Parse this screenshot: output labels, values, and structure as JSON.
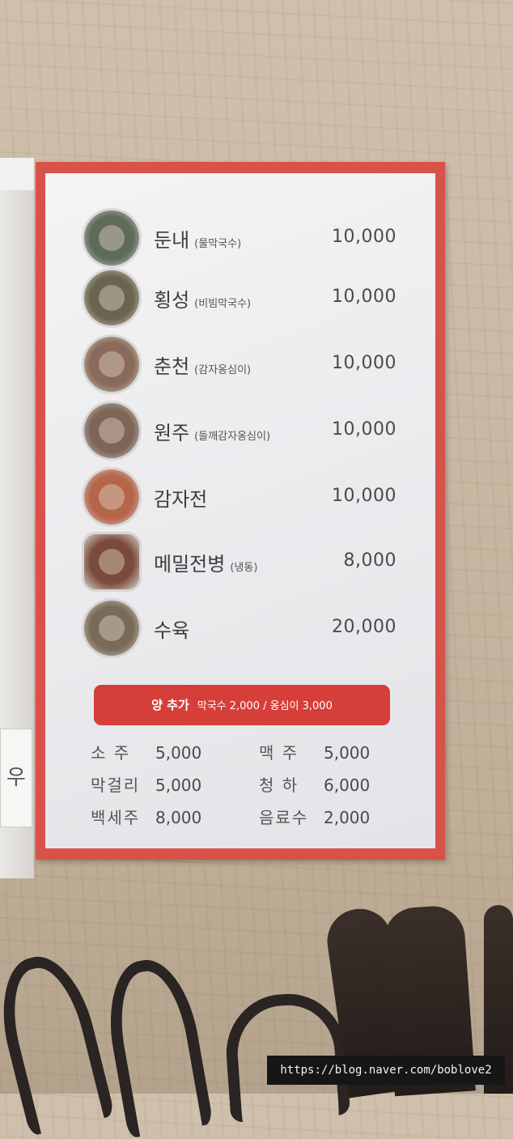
{
  "menu": {
    "items": [
      {
        "name": "둔내",
        "sub": "(물막국수)",
        "price": "10,000",
        "thumb_color": "#5f6a58"
      },
      {
        "name": "횡성",
        "sub": "(비빔막국수)",
        "price": "10,000",
        "thumb_color": "#6b6450"
      },
      {
        "name": "춘천",
        "sub": "(감자옹심이)",
        "price": "10,000",
        "thumb_color": "#8a6a58"
      },
      {
        "name": "원주",
        "sub": "(들깨감자옹심이)",
        "price": "10,000",
        "thumb_color": "#7d6557"
      },
      {
        "name": "감자전",
        "sub": "",
        "price": "10,000",
        "thumb_color": "#b5654a"
      },
      {
        "name": "메밀전병",
        "sub": "(냉동)",
        "price": "8,000",
        "thumb_color": "#7a4a3c"
      },
      {
        "name": "수육",
        "sub": "",
        "price": "20,000",
        "thumb_color": "#7a6a5a"
      }
    ],
    "addon": {
      "label": "양 추가",
      "detail": "막국수 2,000 / 옹심이 3,000"
    },
    "drinks": [
      {
        "name": "소 주",
        "price": "5,000"
      },
      {
        "name": "맥 주",
        "price": "5,000"
      },
      {
        "name": "막걸리",
        "price": "5,000"
      },
      {
        "name": "청 하",
        "price": "6,000"
      },
      {
        "name": "백세주",
        "price": "8,000"
      },
      {
        "name": "음료수",
        "price": "2,000"
      }
    ]
  },
  "wall_note": "우",
  "watermark": "https://blog.naver.com/boblove2",
  "colors": {
    "frame": "#d8524a",
    "addon_bg": "#d63e3a",
    "board_bg": "#f0f0f2",
    "text": "#3d3d3f"
  }
}
